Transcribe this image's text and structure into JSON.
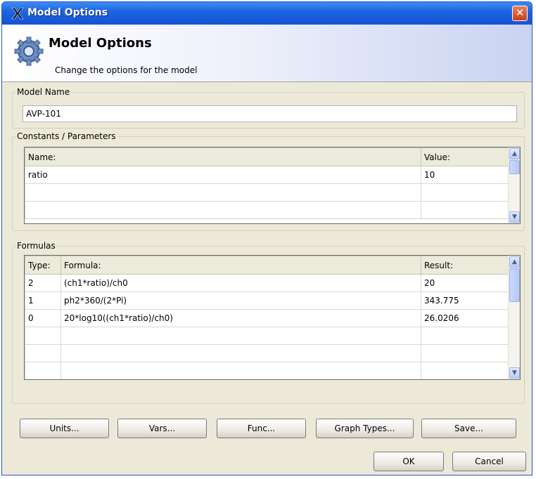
{
  "window": {
    "title": "Model Options",
    "close_label": "✕"
  },
  "header": {
    "title": "Model Options",
    "subtitle": "Change the options for the model"
  },
  "model_name": {
    "label": "Model Name",
    "value": "AVP-101"
  },
  "constants": {
    "label": "Constants / Parameters",
    "columns": [
      "Name:",
      "Value:"
    ],
    "rows": [
      [
        "ratio",
        "10"
      ],
      [
        "",
        ""
      ],
      [
        "",
        ""
      ]
    ]
  },
  "formulas": {
    "label": "Formulas",
    "columns": [
      "Type:",
      "Formula:",
      "Result:"
    ],
    "rows": [
      [
        "2",
        "(ch1*ratio)/ch0",
        "20"
      ],
      [
        "1",
        "ph2*360/(2*Pi)",
        "343.775"
      ],
      [
        "0",
        "20*log10((ch1*ratio)/ch0)",
        "26.0206"
      ],
      [
        "",
        "",
        ""
      ],
      [
        "",
        "",
        ""
      ],
      [
        "",
        "",
        ""
      ]
    ]
  },
  "buttons": {
    "units": "Units...",
    "vars": "Vars...",
    "func": "Func...",
    "graph_types": "Graph Types...",
    "save": "Save...",
    "ok": "OK",
    "cancel": "Cancel"
  },
  "icons": {
    "app": "x-app-icon",
    "header": "gear-icon",
    "scroll_up": "chevron-up-icon",
    "scroll_down": "chevron-down-icon"
  },
  "colors": {
    "titlebar": "#1e64e0",
    "dialog_bg": "#ece9d8",
    "scroll_accent": "#b9cdf6"
  }
}
